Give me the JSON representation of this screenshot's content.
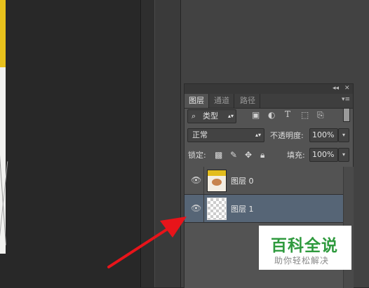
{
  "panel": {
    "tabs": [
      {
        "label": "图层",
        "active": true
      },
      {
        "label": "通道",
        "active": false
      },
      {
        "label": "路径",
        "active": false
      }
    ],
    "filter": {
      "search_glyph": "⌕",
      "kind_label": "类型"
    },
    "blend_mode": "正常",
    "opacity_label": "不透明度:",
    "opacity_value": "100%",
    "lock_label": "锁定:",
    "fill_label": "填充:",
    "fill_value": "100%",
    "layers": [
      {
        "name": "图层 0",
        "visible": true,
        "selected": false,
        "thumbnail": "image-thumbnail"
      },
      {
        "name": "图层 1",
        "visible": true,
        "selected": true,
        "thumbnail": "transparent-thumbnail"
      }
    ]
  },
  "watermark": {
    "title": "百科全说",
    "subtitle": "助你轻松解决"
  },
  "colors": {
    "arrow": "#e8141a",
    "selected_layer": "#566576",
    "watermark_green": "#2f9a3e",
    "panel_bg": "#535353"
  }
}
